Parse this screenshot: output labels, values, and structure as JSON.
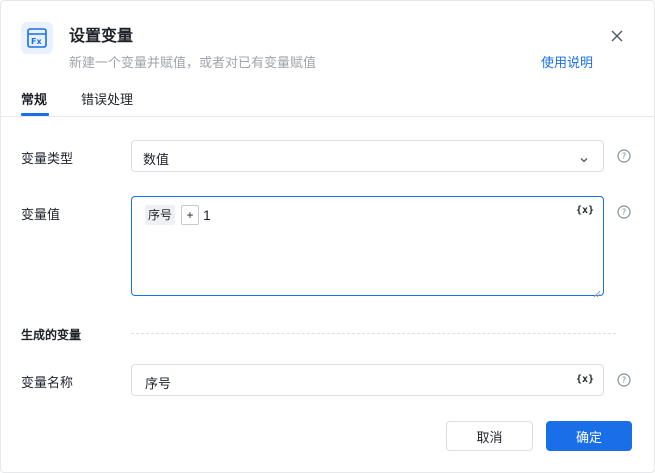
{
  "header": {
    "icon": "fx-variable-icon",
    "title": "设置变量",
    "subtitle": "新建一个变量并赋值，或者对已有变量赋值",
    "help_link": "使用说明",
    "close_icon": "close-icon"
  },
  "tabs": [
    {
      "label": "常规",
      "active": true
    },
    {
      "label": "错误处理",
      "active": false
    }
  ],
  "form": {
    "variable_type": {
      "label": "变量类型",
      "value": "数值"
    },
    "variable_value": {
      "label": "变量值",
      "expression": {
        "token": "序号",
        "operator": "+",
        "literal": "1"
      },
      "variable_icon": "{x}"
    },
    "generated_section": {
      "title": "生成的变量"
    },
    "variable_name": {
      "label": "变量名称",
      "value": "序号",
      "variable_icon": "{x}"
    }
  },
  "footer": {
    "cancel_label": "取消",
    "ok_label": "确定"
  },
  "colors": {
    "accent": "#1a6fe8",
    "icon_bg": "#e8f1fd"
  }
}
